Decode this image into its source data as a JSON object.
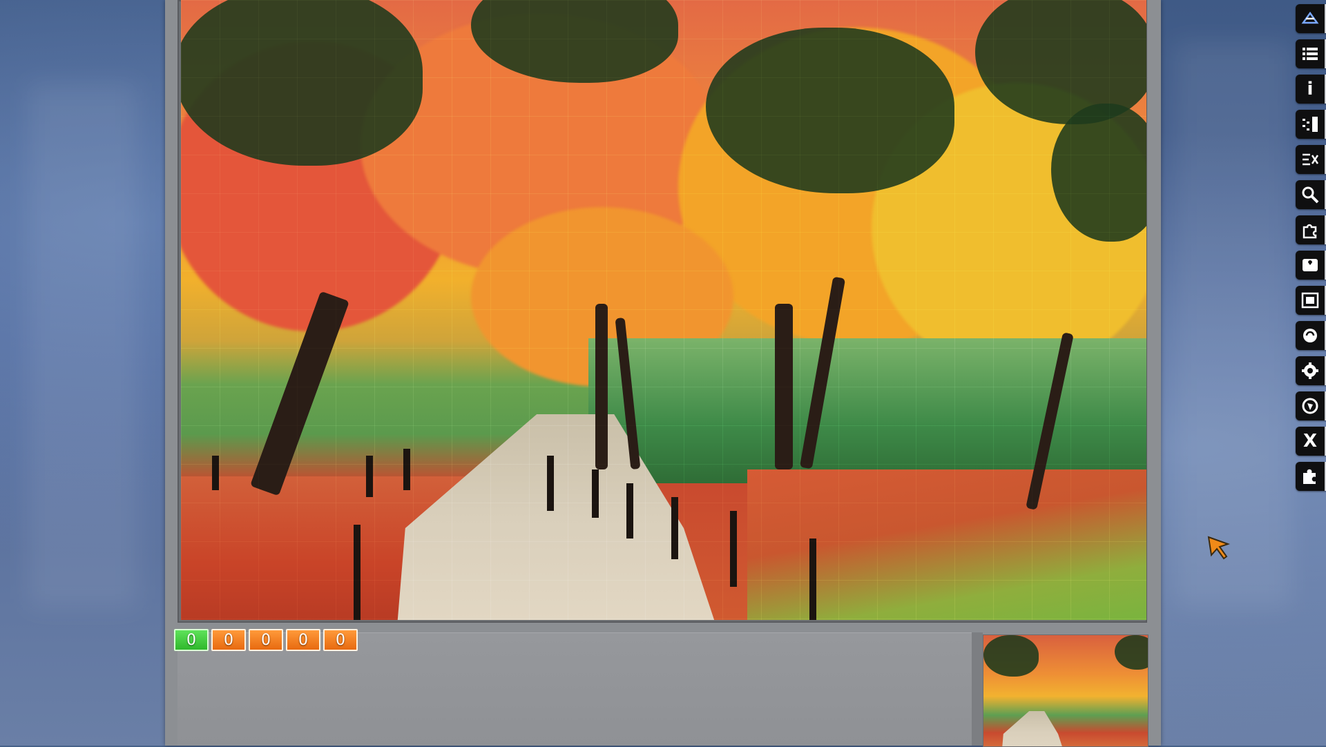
{
  "counters": [
    {
      "value": "0",
      "color": "#3fcf3a"
    },
    {
      "value": "0",
      "color": "#f5821f"
    },
    {
      "value": "0",
      "color": "#f5821f"
    },
    {
      "value": "0",
      "color": "#f5821f"
    },
    {
      "value": "0",
      "color": "#f5821f"
    }
  ],
  "toolbar": {
    "items": [
      {
        "icon": "shuffle-scatter-icon"
      },
      {
        "icon": "list-icon"
      },
      {
        "icon": "info-icon",
        "glyph": "i"
      },
      {
        "icon": "sort-edges-icon"
      },
      {
        "icon": "arrange-pieces-icon"
      },
      {
        "icon": "magnifier-icon"
      },
      {
        "icon": "puzzle-piece-icon"
      },
      {
        "icon": "box-lid-icon"
      },
      {
        "icon": "screenshot-frame-icon"
      },
      {
        "icon": "ghost-image-icon"
      },
      {
        "icon": "settings-gear-icon"
      },
      {
        "icon": "browser-globe-icon"
      },
      {
        "icon": "close-icon",
        "glyph": "X"
      },
      {
        "icon": "puzzle-piece-solid-icon"
      }
    ]
  },
  "colors": {
    "background": "#47628a",
    "panel": "#8c8f93",
    "toolbar_button": "#0f0f10"
  }
}
